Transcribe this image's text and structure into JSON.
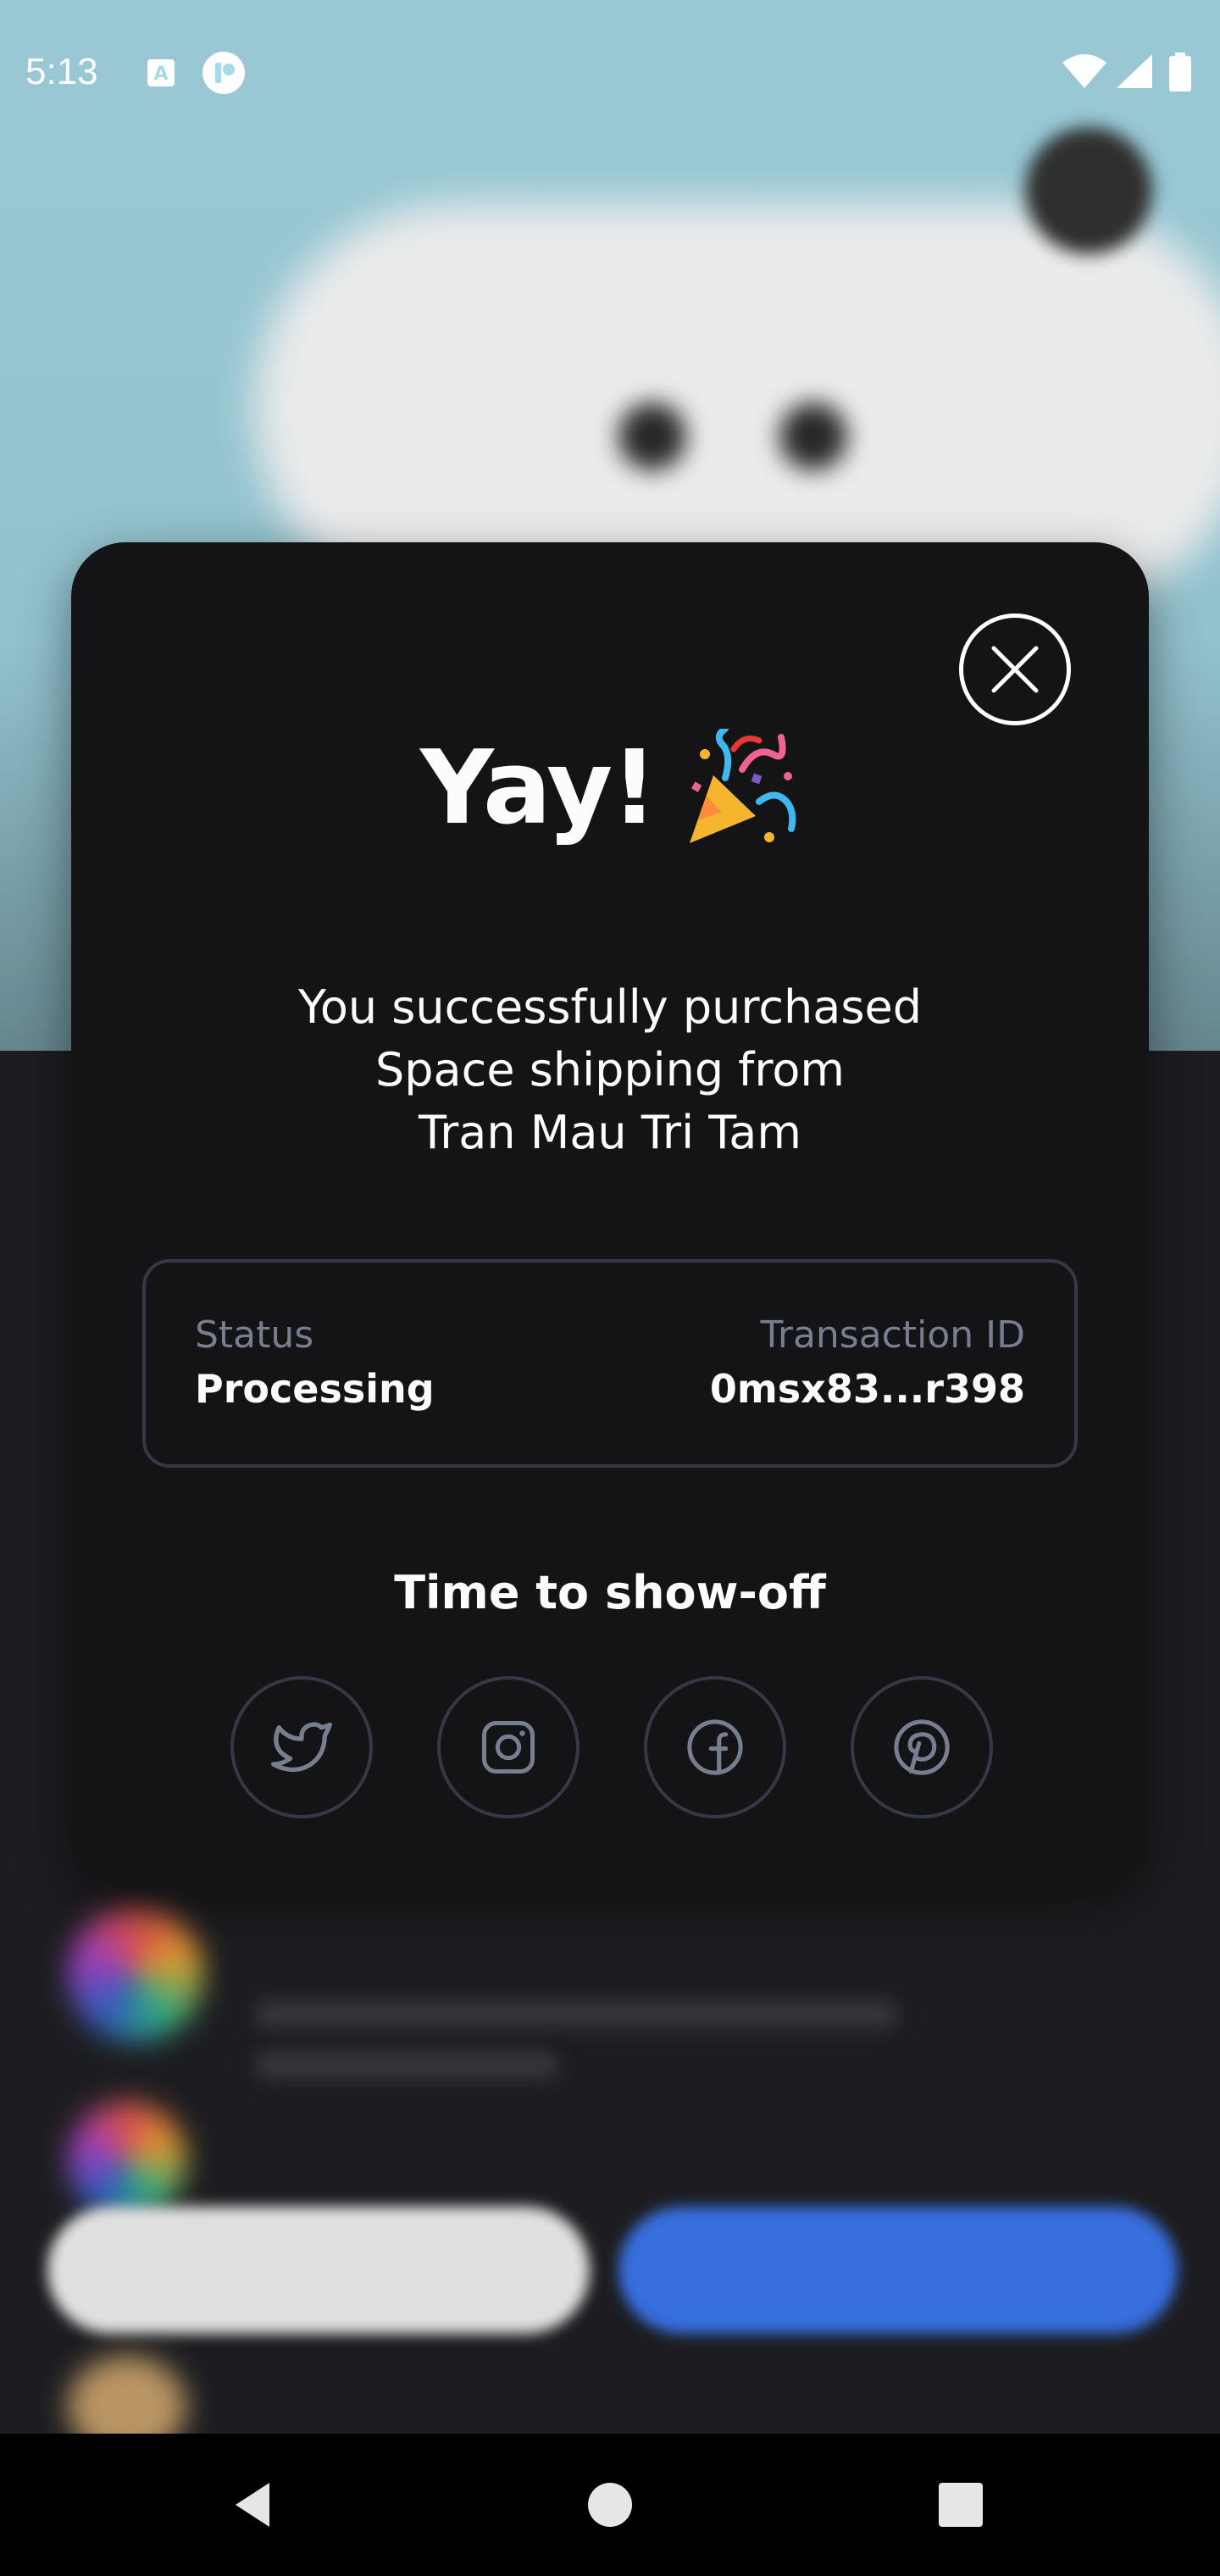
{
  "status_bar": {
    "time": "5:13",
    "icons": [
      "keyboard-a-icon",
      "app-notification-icon",
      "wifi-icon",
      "cellular-signal-icon",
      "battery-icon"
    ]
  },
  "modal": {
    "title": "Yay!",
    "title_emoji": "party-popper-icon",
    "message_lines": [
      "You successfully purchased",
      "Space shipping from",
      "Tran Mau Tri Tam"
    ],
    "details": {
      "status_label": "Status",
      "status_value": "Processing",
      "transaction_label": "Transaction ID",
      "transaction_value": "0msx83...r398"
    },
    "share_heading": "Time to show-off",
    "share_buttons": [
      "twitter-icon",
      "instagram-icon",
      "facebook-icon",
      "pinterest-icon"
    ],
    "close_icon": "close-icon"
  },
  "colors": {
    "modal_bg": "#141416",
    "text_primary": "#fcfcfd",
    "text_secondary": "#777e90",
    "border": "#353945",
    "accent_blue": "#3c79f2"
  },
  "nav_bar": {
    "icons": [
      "back-icon",
      "home-icon",
      "recents-icon"
    ]
  }
}
